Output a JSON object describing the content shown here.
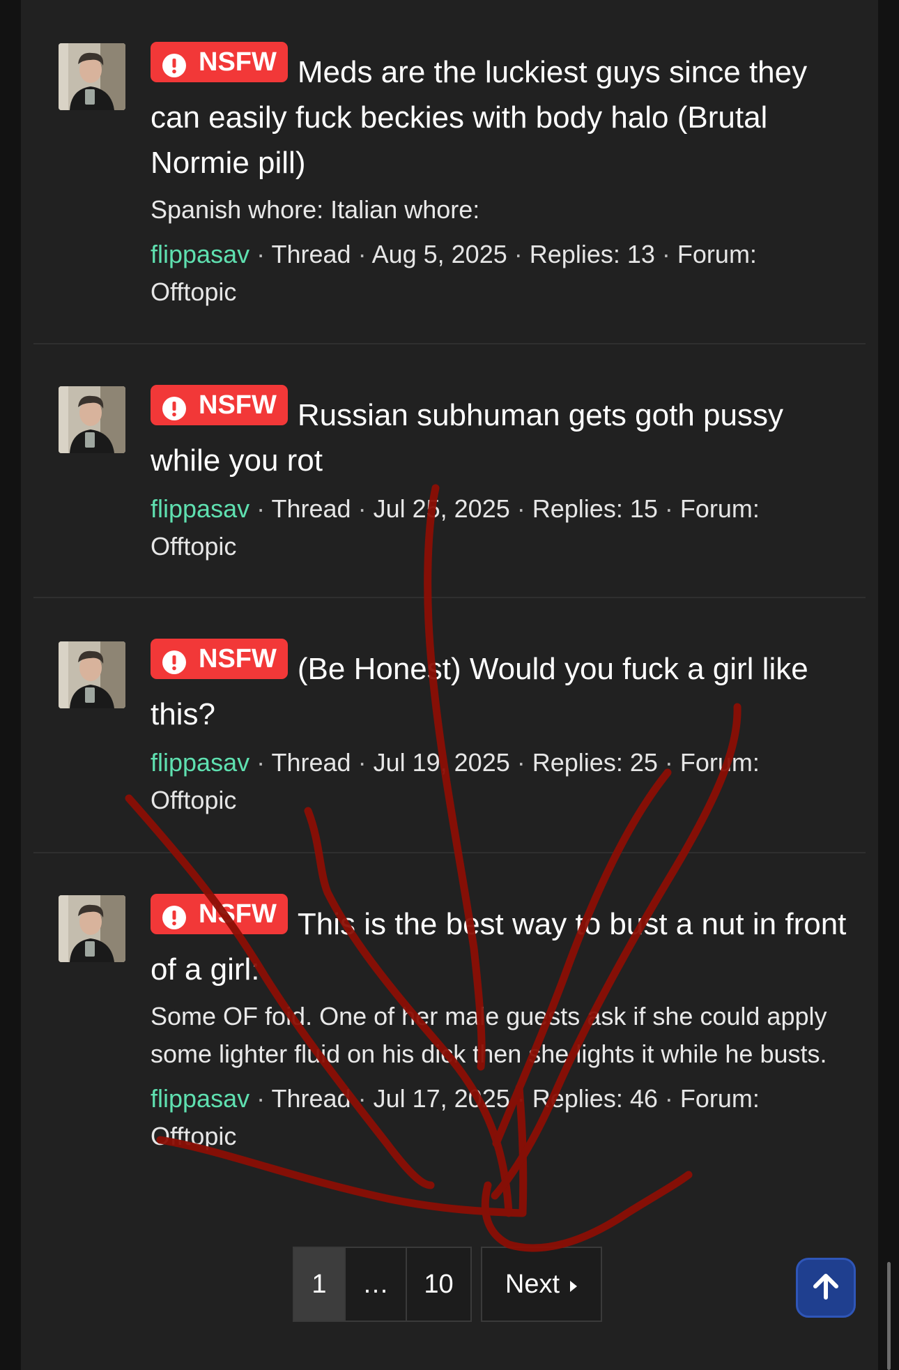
{
  "results": [
    {
      "badge": "NSFW",
      "title": "Meds are the luckiest guys since they can easily fuck beckies with body halo (Brutal Normie pill)",
      "snippet": "Spanish whore: Italian whore:",
      "author": "flippasav",
      "type": "Thread",
      "date": "Aug 5, 2025",
      "replies": "Replies: 13",
      "forum_label": "Forum:",
      "forum": "Offtopic"
    },
    {
      "badge": "NSFW",
      "title": "Russian subhuman gets goth pussy while you rot",
      "snippet": "",
      "author": "flippasav",
      "type": "Thread",
      "date": "Jul 25, 2025",
      "replies": "Replies: 15",
      "forum_label": "Forum:",
      "forum": "Offtopic"
    },
    {
      "badge": "NSFW",
      "title": "(Be Honest) Would you fuck a girl like this?",
      "snippet": "",
      "author": "flippasav",
      "type": "Thread",
      "date": "Jul 19, 2025",
      "replies": "Replies: 25",
      "forum_label": "Forum:",
      "forum": "Offtopic"
    },
    {
      "badge": "NSFW",
      "title": "This is the best way to bust a nut in front of a girl:",
      "snippet": "Some OF foid. One of her male guests ask if she could apply some lighter fluid on his dick then she lights it while he busts.",
      "author": "flippasav",
      "type": "Thread",
      "date": "Jul 17, 2025",
      "replies": "Replies: 46",
      "forum_label": "Forum:",
      "forum": "Offtopic"
    }
  ],
  "meta_separator": "·",
  "pagination": {
    "current": "1",
    "ellipsis": "…",
    "last": "10",
    "next": "Next"
  },
  "colors": {
    "badge": "#f23838",
    "author": "#5fe0b0",
    "panel": "#212121",
    "scroll_top_button": "#1f3f8f",
    "scribble": "#8b0f05"
  },
  "icons": {
    "badge_icon": "exclamation-circle-icon",
    "next_icon": "caret-right-icon",
    "scroll_top_icon": "arrow-up-icon"
  }
}
